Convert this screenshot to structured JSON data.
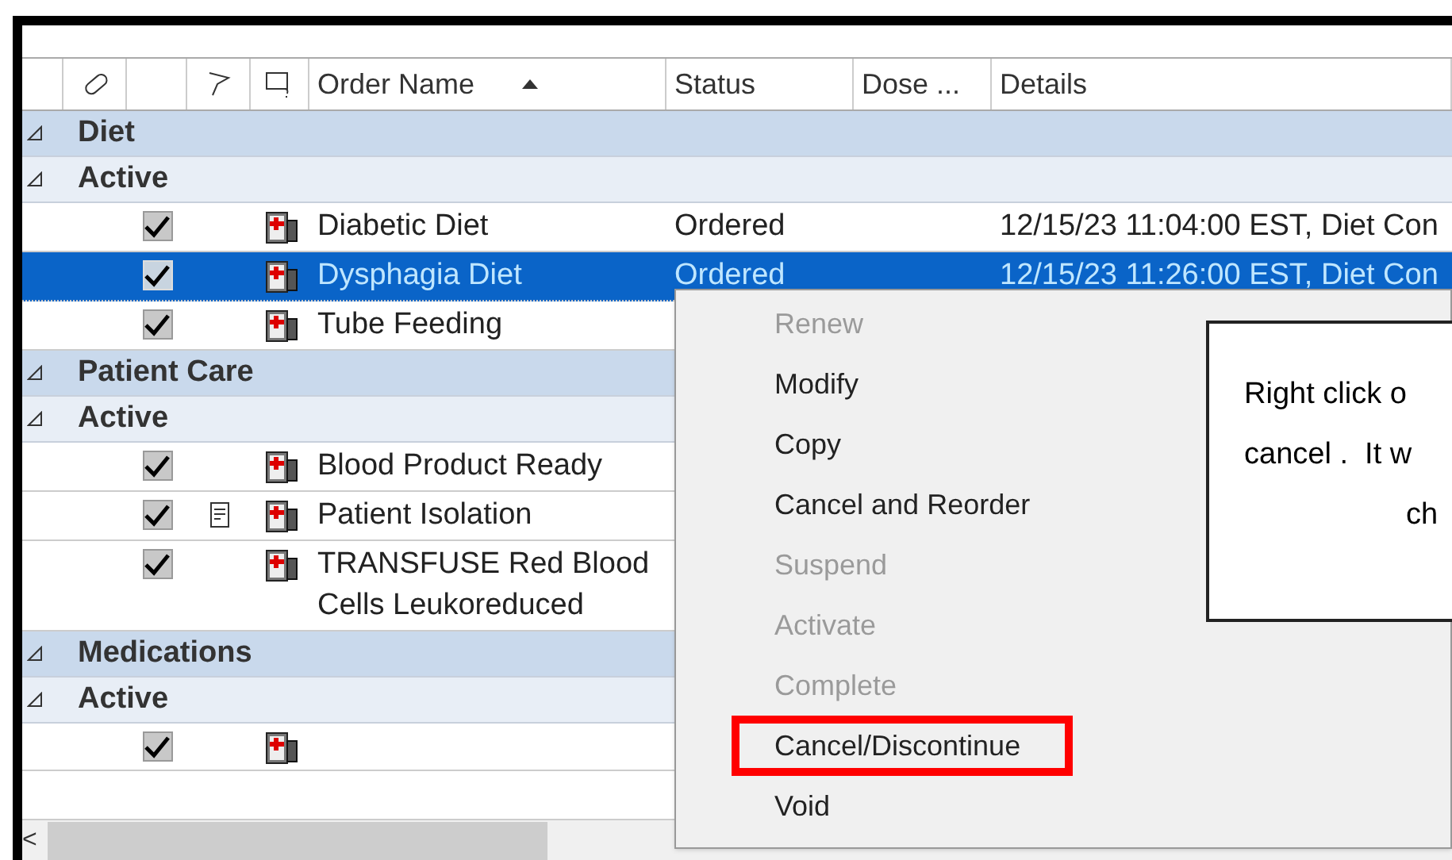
{
  "columns": [
    {
      "label": "Order Name",
      "sorted": true
    },
    {
      "label": "Status",
      "sorted": false
    },
    {
      "label": "Dose ...",
      "sorted": false
    },
    {
      "label": "Details",
      "sorted": false
    }
  ],
  "rows": [
    {
      "kind": "group",
      "label": "Diet"
    },
    {
      "kind": "subgroup",
      "label": "Active"
    },
    {
      "kind": "order",
      "checked": true,
      "note": false,
      "name": "Diabetic Diet",
      "status": "Ordered",
      "details": "12/15/23 11:04:00 EST, Diet Con",
      "selected": false
    },
    {
      "kind": "order",
      "checked": true,
      "note": false,
      "name": "Dysphagia Diet",
      "status": "Ordered",
      "details": "12/15/23 11:26:00 EST, Diet Con",
      "selected": true
    },
    {
      "kind": "order",
      "checked": true,
      "note": false,
      "name": "Tube Feeding",
      "selected": false
    },
    {
      "kind": "group",
      "label": "Patient Care"
    },
    {
      "kind": "subgroup",
      "label": "Active"
    },
    {
      "kind": "order",
      "checked": true,
      "note": false,
      "name": "Blood Product Ready",
      "selected": false
    },
    {
      "kind": "order",
      "checked": true,
      "note": true,
      "name": "Patient Isolation",
      "selected": false
    },
    {
      "kind": "order",
      "checked": true,
      "note": false,
      "name": "TRANSFUSE Red Blood Cells Leukoreduced",
      "selected": false
    },
    {
      "kind": "group",
      "label": "Medications"
    },
    {
      "kind": "subgroup",
      "label": "Active"
    },
    {
      "kind": "order",
      "checked": true,
      "note": false,
      "selected": false
    }
  ],
  "context_menu": [
    {
      "label": "Renew",
      "disabled": true,
      "highlighted": false
    },
    {
      "label": "Modify",
      "disabled": false,
      "highlighted": false
    },
    {
      "label": "Copy",
      "disabled": false,
      "highlighted": false
    },
    {
      "label": "Cancel and Reorder",
      "disabled": false,
      "highlighted": false
    },
    {
      "label": "Suspend",
      "disabled": true,
      "highlighted": false
    },
    {
      "label": "Activate",
      "disabled": true,
      "highlighted": false
    },
    {
      "label": "Complete",
      "disabled": true,
      "highlighted": false
    },
    {
      "label": "Cancel/Discontinue",
      "disabled": false,
      "highlighted": true
    },
    {
      "label": "Void",
      "disabled": false,
      "highlighted": false
    }
  ],
  "callout": {
    "lines": [
      "Right click o",
      "cancel .  It w",
      "ch"
    ]
  },
  "scrollbar": {
    "arrow": "<"
  }
}
